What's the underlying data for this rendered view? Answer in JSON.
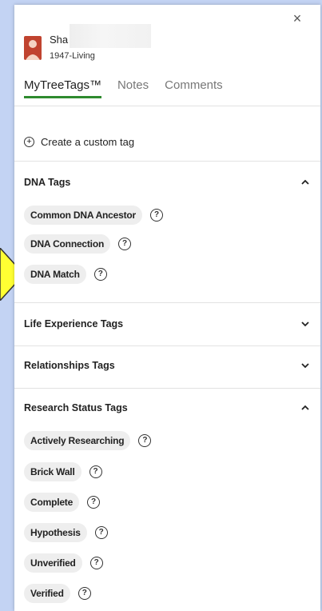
{
  "header": {
    "close_label": "×",
    "person_name": "Sha",
    "person_dates": "1947-Living"
  },
  "tabs": [
    {
      "label": "MyTreeTags™",
      "active": true
    },
    {
      "label": "Notes",
      "active": false
    },
    {
      "label": "Comments",
      "active": false
    }
  ],
  "create_tag_label": "Create a custom tag",
  "sections": {
    "dna": {
      "title": "DNA Tags",
      "expanded": true,
      "tags": [
        "Common DNA Ancestor",
        "DNA Connection",
        "DNA Match"
      ]
    },
    "life": {
      "title": "Life Experience Tags",
      "expanded": false
    },
    "relationships": {
      "title": "Relationships Tags",
      "expanded": false
    },
    "research": {
      "title": "Research Status Tags",
      "expanded": true,
      "tags": [
        "Actively Researching",
        "Brick Wall",
        "Complete",
        "Hypothesis",
        "Unverified",
        "Verified"
      ]
    }
  },
  "help_glyph": "?",
  "colors": {
    "accent_tab_underline": "#2e8a2e",
    "pointer_arrow": "#ffff33",
    "background": "#c3d3f3",
    "avatar": "#c0432f"
  }
}
